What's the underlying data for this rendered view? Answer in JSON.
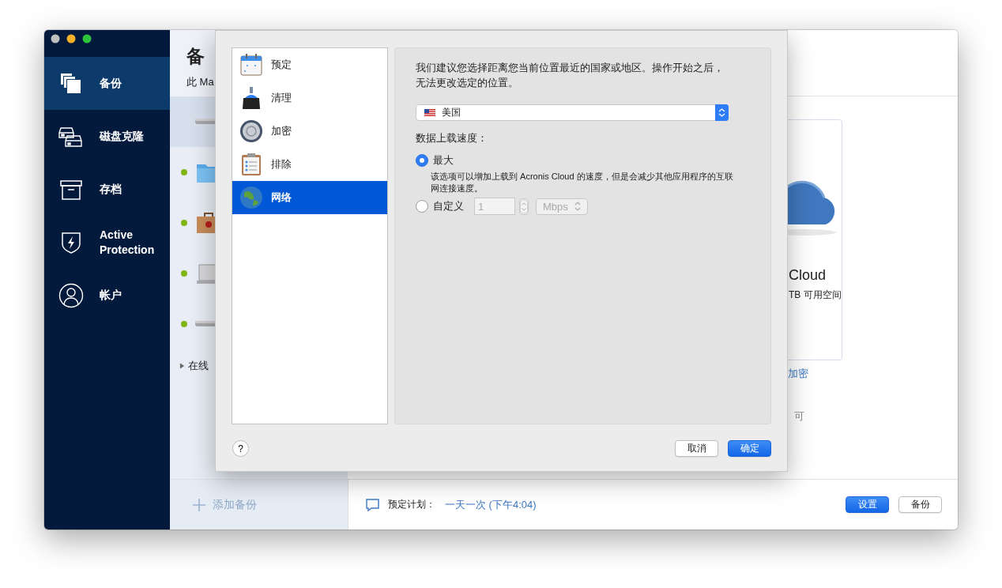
{
  "sidebar": {
    "items": [
      {
        "label": "备份",
        "selected": true
      },
      {
        "label": "磁盘克隆",
        "selected": false
      },
      {
        "label": "存档",
        "selected": false
      },
      {
        "label": "Active Protection",
        "selected": false
      },
      {
        "label": "帐户",
        "selected": false
      }
    ]
  },
  "backup_list": {
    "title": "备",
    "subtitle": "此 Ma",
    "rows": [
      {
        "selected": true,
        "status_dot": false
      },
      {
        "selected": false,
        "status_dot": true
      },
      {
        "selected": false,
        "status_dot": true
      },
      {
        "selected": false,
        "status_dot": true
      },
      {
        "selected": false,
        "status_dot": true
      }
    ],
    "section": {
      "label": "在线",
      "expanded": false
    },
    "add_button": "添加备份"
  },
  "destination": {
    "card_title": "Cloud",
    "card_subtitle": "TB 可用空间",
    "link": "加密",
    "note": "可"
  },
  "footer": {
    "schedule_label": "预定计划：",
    "schedule_value": "一天一次 (下午4:04)",
    "buttons": [
      {
        "label": "设置",
        "primary": true
      },
      {
        "label": "备份",
        "primary": false
      }
    ]
  },
  "dialog": {
    "categories": [
      {
        "label": "预定",
        "selected": false
      },
      {
        "label": "清理",
        "selected": false
      },
      {
        "label": "加密",
        "selected": false
      },
      {
        "label": "排除",
        "selected": false
      },
      {
        "label": "网络",
        "selected": true
      }
    ],
    "region_note": "我们建议您选择距离您当前位置最近的国家或地区。操作开始之后，无法更改选定的位置。",
    "region_select": {
      "value": "美国"
    },
    "speed_label": "数据上载速度：",
    "options": [
      {
        "label": "最大",
        "selected": true,
        "description": "该选项可以增加上载到 Acronis Cloud 的速度，但是会减少其他应用程序的互联网连接速度。"
      },
      {
        "label": "自定义",
        "selected": false
      }
    ],
    "custom_value": "1",
    "unit": "Mbps",
    "custom_disabled": true,
    "help": "?",
    "buttons": [
      {
        "label": "取消",
        "primary": false
      },
      {
        "label": "确定",
        "primary": true
      }
    ]
  }
}
